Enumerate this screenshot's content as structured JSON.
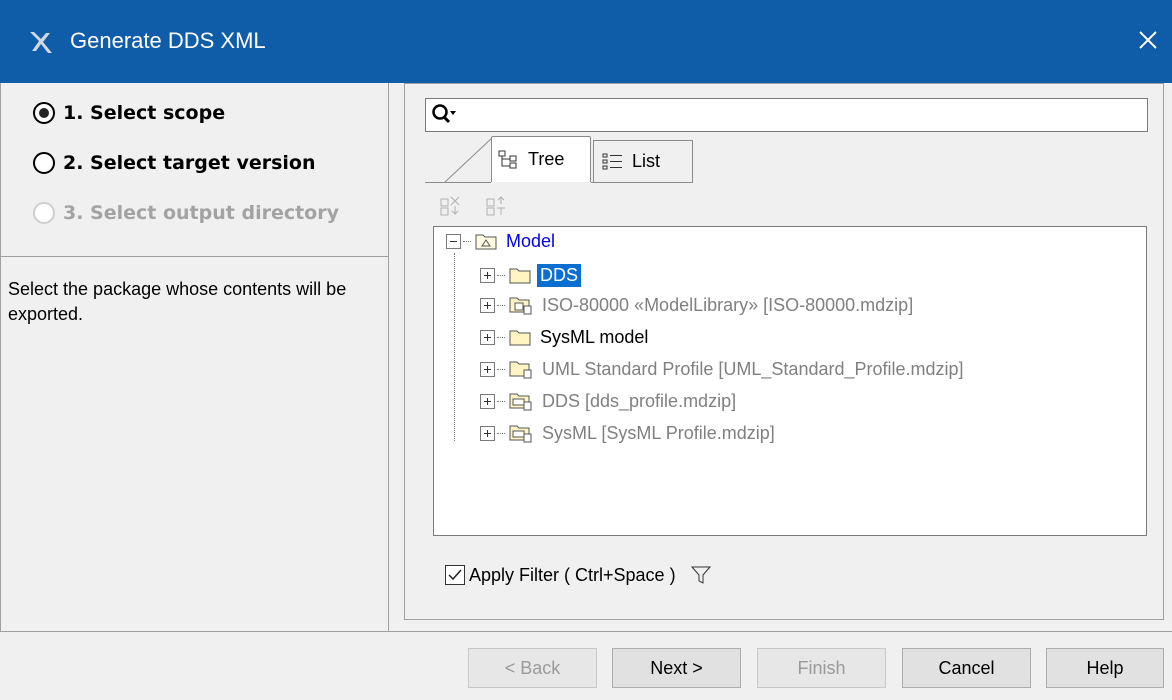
{
  "window": {
    "title": "Generate DDS XML",
    "close_icon": "close-icon"
  },
  "steps": [
    {
      "label": "1. Select scope",
      "selected": true,
      "enabled": true
    },
    {
      "label": "2. Select target version",
      "selected": false,
      "enabled": true
    },
    {
      "label": "3. Select output directory",
      "selected": false,
      "enabled": false
    }
  ],
  "description": "Select the package whose contents will be exported.",
  "search": {
    "value": "",
    "placeholder": ""
  },
  "tabs": [
    {
      "label": "Tree",
      "active": true,
      "icon": "tree-icon"
    },
    {
      "label": "List",
      "active": false,
      "icon": "list-icon"
    }
  ],
  "tree": {
    "root": {
      "label": "Model",
      "expanded": true
    },
    "children": [
      {
        "label": "DDS",
        "icon": "folder-icon",
        "selected": true
      },
      {
        "label": "ISO-80000 «ModelLibrary» [ISO-80000.mdzip]",
        "icon": "library-package-icon",
        "read_only": true
      },
      {
        "label": "SysML model",
        "icon": "folder-icon"
      },
      {
        "label": "UML Standard Profile [UML_Standard_Profile.mdzip]",
        "icon": "shared-package-icon",
        "read_only": true
      },
      {
        "label": "DDS [dds_profile.mdzip]",
        "icon": "profile-icon",
        "read_only": true
      },
      {
        "label": "SysML [SysML Profile.mdzip]",
        "icon": "profile-icon",
        "read_only": true
      }
    ]
  },
  "filter": {
    "label": "Apply Filter ( Ctrl+Space )",
    "checked": true
  },
  "buttons": {
    "back": "< Back",
    "next": "Next >",
    "finish": "Finish",
    "cancel": "Cancel",
    "help": "Help"
  },
  "colors": {
    "titlebar": "#0f5ca8",
    "selection": "#0b6fd1",
    "link": "#0000ee",
    "disabled": "#9a9a9a"
  }
}
